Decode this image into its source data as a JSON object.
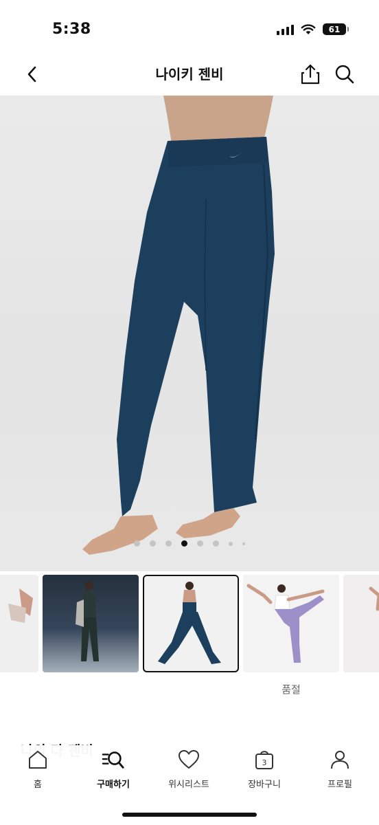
{
  "status_bar": {
    "time": "5:38",
    "battery_level": "61",
    "icons": [
      "signal-icon",
      "wifi-icon",
      "battery-icon"
    ]
  },
  "header": {
    "title": "나이키 젠비",
    "icons": [
      "back-chevron-icon",
      "share-icon",
      "search-icon"
    ]
  },
  "carousel": {
    "total": 8,
    "active_index": 3
  },
  "thumbnails": {
    "selected_index": 2,
    "status_label": "품절"
  },
  "section_peek": "나의 다 젠비",
  "bottom_nav": {
    "active_index": 1,
    "items": [
      {
        "label": "홈",
        "icon": "home-icon"
      },
      {
        "label": "구매하기",
        "icon": "shop-search-icon"
      },
      {
        "label": "위시리스트",
        "icon": "heart-icon"
      },
      {
        "label": "장바구니",
        "icon": "cart-icon",
        "badge": "3"
      },
      {
        "label": "프로필",
        "icon": "profile-icon"
      }
    ]
  },
  "colors": {
    "accent": "#111111",
    "product_navy": "#1d3f5e",
    "thumb_lavender": "#9d8fc7"
  }
}
